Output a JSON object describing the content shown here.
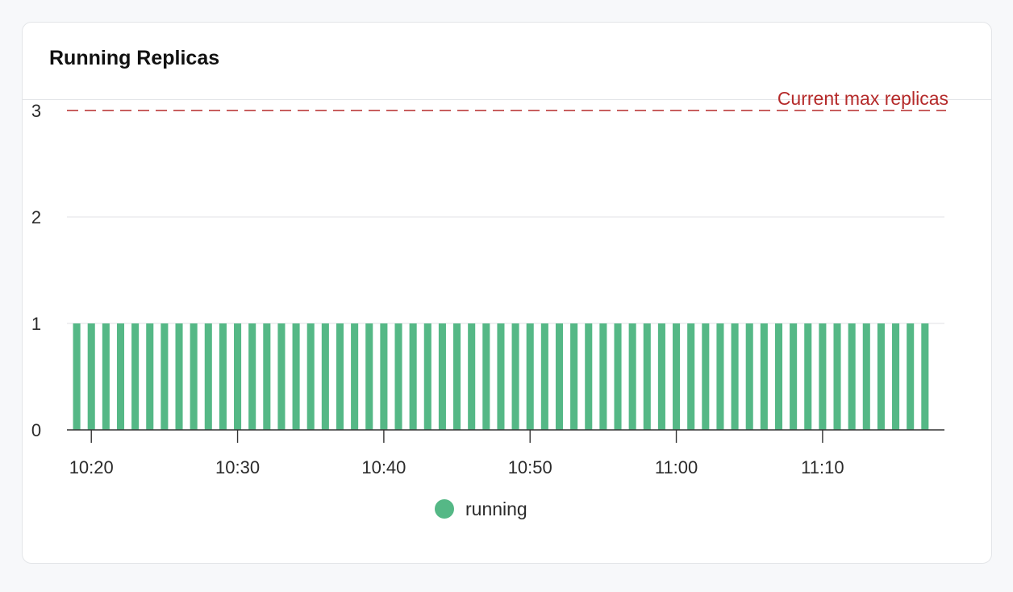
{
  "card": {
    "title": "Running Replicas"
  },
  "colors": {
    "bar": "#55b886",
    "reference_line": "#b52a2a",
    "grid": "#e6e7ea",
    "axis": "#333333"
  },
  "chart_data": {
    "type": "bar",
    "title": "Running Replicas",
    "xlabel": "",
    "ylabel": "",
    "ylim": [
      0,
      3
    ],
    "y_ticks": [
      0,
      1,
      2,
      3
    ],
    "x_range": [
      "10:18:20",
      "11:18:20"
    ],
    "x_ticks": [
      "10:20",
      "10:30",
      "10:40",
      "10:50",
      "11:00",
      "11:10"
    ],
    "bar_interval_minutes": 1,
    "grid": true,
    "legend_position": "bottom-center",
    "series": [
      {
        "name": "running",
        "color": "#55b886",
        "x_start": "10:19",
        "values": [
          1,
          1,
          1,
          1,
          1,
          1,
          1,
          1,
          1,
          1,
          1,
          1,
          1,
          1,
          1,
          1,
          1,
          1,
          1,
          1,
          1,
          1,
          1,
          1,
          1,
          1,
          1,
          1,
          1,
          1,
          1,
          1,
          1,
          1,
          1,
          1,
          1,
          1,
          1,
          1,
          1,
          1,
          1,
          1,
          1,
          1,
          1,
          1,
          1,
          1,
          1,
          1,
          1,
          1,
          1,
          1,
          1,
          1,
          1
        ]
      }
    ],
    "reference_lines": [
      {
        "label": "Current max replicas",
        "value": 3,
        "style": "dashed",
        "color": "#b52a2a"
      }
    ]
  }
}
